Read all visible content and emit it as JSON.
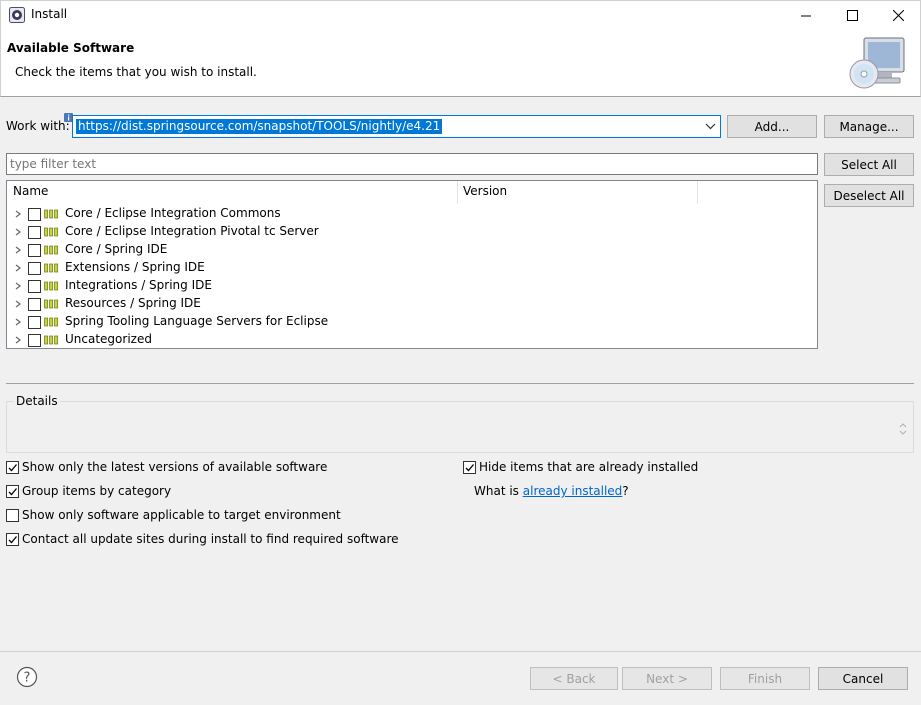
{
  "window": {
    "title": "Install",
    "controls": [
      "minimize-icon",
      "maximize-icon",
      "close-icon"
    ]
  },
  "banner": {
    "title": "Available Software",
    "description": "Check the items that you wish to install."
  },
  "work_with": {
    "label": "Work with:",
    "value": "https://dist.springsource.com/snapshot/TOOLS/nightly/e4.21",
    "add_label": "Add...",
    "manage_label": "Manage..."
  },
  "filter": {
    "placeholder": "type filter text"
  },
  "actions": {
    "select_all": "Select All",
    "deselect_all": "Deselect All"
  },
  "tree": {
    "columns": [
      "Name",
      "Version"
    ],
    "items": [
      {
        "label": "Core / Eclipse Integration Commons",
        "checked": false
      },
      {
        "label": "Core / Eclipse Integration Pivotal tc Server",
        "checked": false
      },
      {
        "label": "Core / Spring IDE",
        "checked": false
      },
      {
        "label": "Extensions / Spring IDE",
        "checked": false
      },
      {
        "label": "Integrations / Spring IDE",
        "checked": false
      },
      {
        "label": "Resources / Spring IDE",
        "checked": false
      },
      {
        "label": "Spring Tooling Language Servers for Eclipse",
        "checked": false
      },
      {
        "label": "Uncategorized",
        "checked": false
      }
    ]
  },
  "details": {
    "label": "Details"
  },
  "options": {
    "latest_versions": {
      "label": "Show only the latest versions of available software",
      "checked": true
    },
    "group_by_category": {
      "label": "Group items by category",
      "checked": true
    },
    "target_env": {
      "label": "Show only software applicable to target environment",
      "checked": false
    },
    "contact_sites": {
      "label": "Contact all update sites during install to find required software",
      "checked": true
    },
    "hide_installed": {
      "label": "Hide items that are already installed",
      "checked": true
    },
    "what_is_prefix": "What is ",
    "what_is_link": "already installed",
    "what_is_suffix": "?"
  },
  "footer": {
    "back": "< Back",
    "next": "Next >",
    "finish": "Finish",
    "cancel": "Cancel"
  },
  "colors": {
    "accent": "#0078d7",
    "link": "#0066cc",
    "package_icon": "#8a9a1a"
  }
}
